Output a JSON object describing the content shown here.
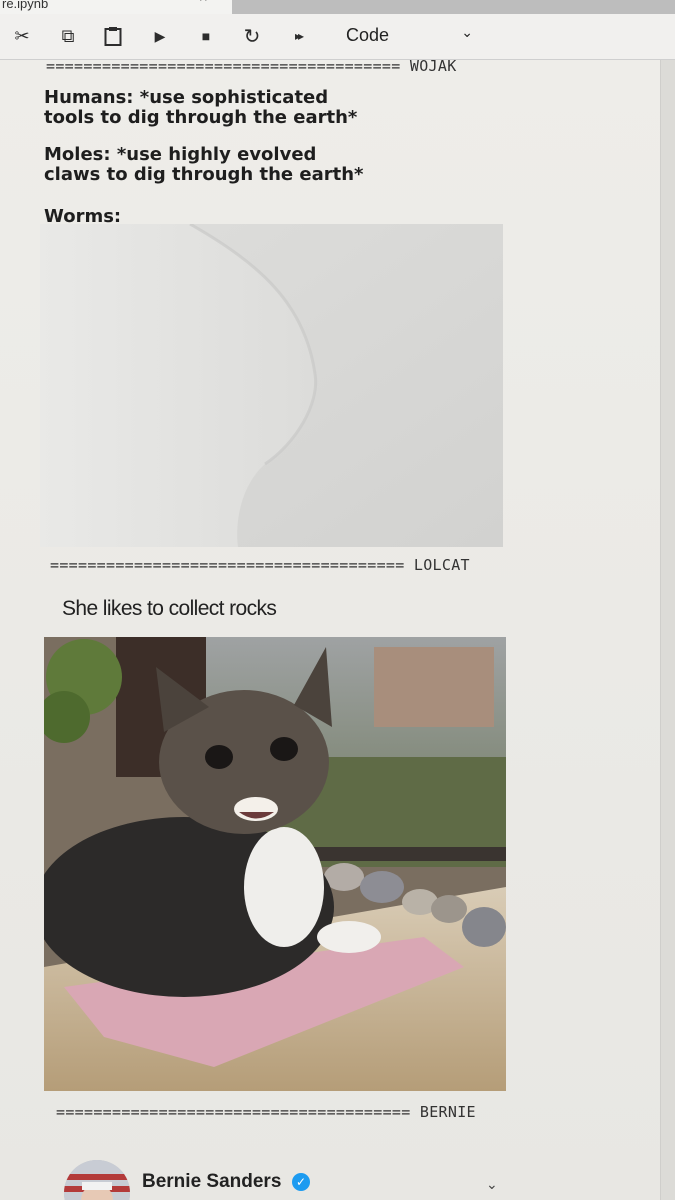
{
  "tab": {
    "title": "re.ipynb",
    "close_glyph": "^"
  },
  "toolbar": {
    "buttons": [
      {
        "icon": "scissors-icon",
        "glyph": "✂"
      },
      {
        "icon": "copy-icon",
        "glyph": "⧉"
      },
      {
        "icon": "paste-icon",
        "glyph": "📋"
      },
      {
        "icon": "run-icon",
        "glyph": "▶"
      },
      {
        "icon": "stop-icon",
        "glyph": "■"
      },
      {
        "icon": "restart-icon",
        "glyph": "↻"
      },
      {
        "icon": "fast-forward-icon",
        "glyph": "▸▸"
      }
    ],
    "cell_type": "Code",
    "chevron": "⌄"
  },
  "cells": {
    "wojak": {
      "separator": "====================================== WOJAK",
      "line1": "Humans: *use sophisticated",
      "line2": "tools to dig through the earth*",
      "line3": "Moles: *use highly evolved",
      "line4": "claws to dig through the earth*",
      "line5": "Worms:"
    },
    "lolcat": {
      "separator": "====================================== LOLCAT",
      "caption": "She likes to collect rocks"
    },
    "bernie": {
      "separator": "====================================== BERNIE",
      "tweet_name": "Bernie Sanders",
      "verified_glyph": "✓",
      "chevron": "⌄"
    }
  },
  "colors": {
    "toolbar_bg": "#f1f0ee",
    "page_bg": "#eceae6",
    "verified_blue": "#1d9bf0"
  }
}
